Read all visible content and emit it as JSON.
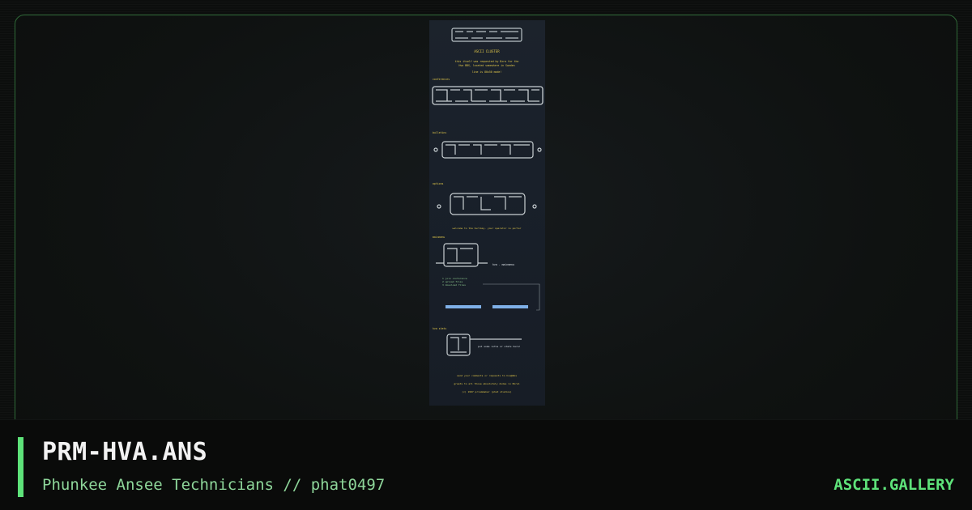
{
  "card": {
    "title": "PRM-HVA.ANS",
    "subtitle": "Phunkee Ansee Technicians // phat0497",
    "brand": "ASCII.GALLERY"
  },
  "artwork": {
    "lines": [
      "ASCII CLUSTER",
      "this itself was requested by Bzra for the",
      "Hva BBS, located somewhere in Sweden",
      "line is 80x50 mode!",
      "conferences",
      "bulletins",
      "options",
      "welcome to the hurlbay. your operator is porter",
      "mainmenu",
      "hva - mainmenu",
      "1  join conference",
      "2  upload files",
      "3  download files",
      "hva stats",
      "put some infos or stats here!",
      "send your comments or requests to hva@bbs",
      "greets to all those absolutely dudes in Bzral",
      "(c) 1997 prismmaker (phat studios)"
    ]
  },
  "colors": {
    "accent": "#5ee37a",
    "frame_border": "#2f6a38",
    "art_yellow": "#e2c84a",
    "art_green": "#8ec98e"
  }
}
